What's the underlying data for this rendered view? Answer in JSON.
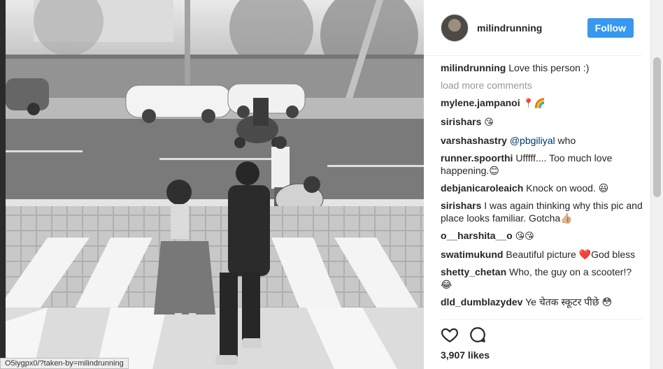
{
  "post": {
    "username": "milindrunning",
    "follow_label": "Follow",
    "likes": "3,907 likes"
  },
  "comments": {
    "load_more": "load more comments",
    "caption": {
      "user": "milindrunning",
      "text": "Love this person :)"
    },
    "items": [
      {
        "user": "mylene.jampanoi",
        "text": "📍🌈"
      },
      {
        "user": "sirishars",
        "text": "😘"
      },
      {
        "user": "varshashastry",
        "mention": "@pbgiliyal",
        "text": "who"
      },
      {
        "user": "runner.spoorthi",
        "text": "Ufffff.... Too much love happening.😊"
      },
      {
        "user": "debjanicaroleaich",
        "text": "Knock on wood. 😃"
      },
      {
        "user": "sirishars",
        "text": "I was again thinking why this pic and place looks familiar. Gotcha👍🏼"
      },
      {
        "user": "o__harshita__o",
        "text": "😘😘"
      },
      {
        "user": "swatimukund",
        "text": "Beautiful picture ❤️God bless"
      },
      {
        "user": "shetty_chetan",
        "text": "Who, the guy on a scooter!? 😂"
      },
      {
        "user": "dld_dumblazydev",
        "text": "Ye चेतक स्कूटर पीछे 😳"
      }
    ]
  },
  "icons": [
    "heart-icon",
    "comment-icon"
  ],
  "status_bar": {
    "url": "O5iygpx0/?taken-by=milindrunning"
  },
  "colors": {
    "follow": "#3897f0",
    "text": "#262626",
    "muted": "#999999"
  }
}
